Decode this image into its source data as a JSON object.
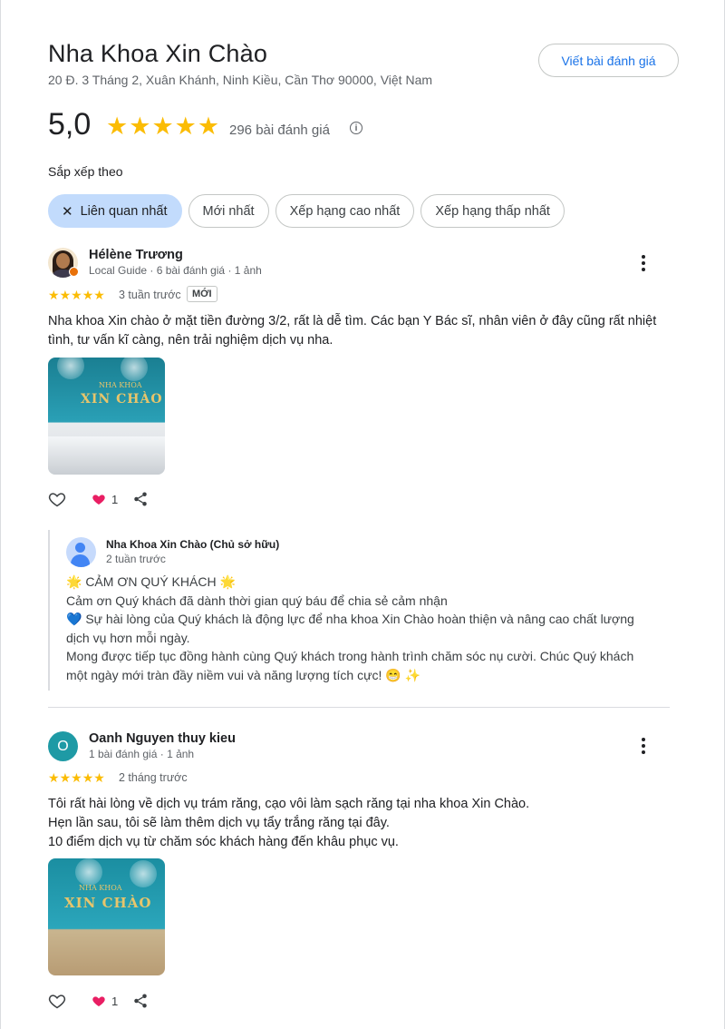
{
  "header": {
    "title": "Nha Khoa Xin Chào",
    "address": "20 Đ. 3 Tháng 2, Xuân Khánh, Ninh Kiều, Cần Thơ 90000, Việt Nam",
    "write_review_label": "Viết bài đánh giá"
  },
  "summary": {
    "rating": "5,0",
    "stars": 5,
    "review_count_label": "296 bài đánh giá",
    "info_icon": "info-icon"
  },
  "sort": {
    "label": "Sắp xếp theo",
    "options": [
      {
        "label": "Liên quan nhất",
        "selected": true
      },
      {
        "label": "Mới nhất",
        "selected": false
      },
      {
        "label": "Xếp hạng cao nhất",
        "selected": false
      },
      {
        "label": "Xếp hạng thấp nhất",
        "selected": false
      }
    ]
  },
  "reviews": [
    {
      "name": "Hélène Trương",
      "meta": "Local Guide · 6 bài đánh giá · 1 ảnh",
      "stars": 5,
      "time": "3 tuần trước",
      "badge": "MỚI",
      "text_lines": [
        "Nha khoa Xin chào ở mặt tiền đường 3/2, rất là dễ tìm. Các bạn Y Bác sĩ, nhân viên ở đây cũng rất nhiệt",
        "tình, tư vấn kĩ càng, nên trải nghiệm dịch vụ nha."
      ],
      "photo_sign_small": "NHA KHOA",
      "photo_sign": "XIN CHÀO",
      "likes": "1",
      "owner_reply": {
        "name": "Nha Khoa Xin Chào (Chủ sở hữu)",
        "time": "2 tuần trước",
        "lines": [
          "🌟 CẢM ƠN QUÝ KHÁCH 🌟",
          "Cảm ơn Quý khách đã dành thời gian quý báu để chia sẻ cảm nhận",
          "💙 Sự hài lòng của Quý khách là động lực để nha khoa Xin Chào hoàn thiện và nâng cao chất lượng",
          "dịch vụ hơn mỗi ngày.",
          "Mong được tiếp tục đồng hành cùng Quý khách trong hành trình chăm sóc nụ cười. Chúc Quý khách",
          "một ngày mới tràn đầy niềm vui và năng lượng tích cực! 😁 ✨"
        ]
      }
    },
    {
      "name": "Oanh Nguyen thuy kieu",
      "avatar_letter": "O",
      "meta": "1 bài đánh giá · 1 ảnh",
      "stars": 5,
      "time": "2 tháng trước",
      "text_lines": [
        "Tôi rất hài lòng về dịch vụ trám răng, cạo vôi làm sạch răng tại nha khoa Xin Chào.",
        "Hẹn lần sau, tôi sẽ làm thêm dịch vụ tẩy trắng răng tại đây.",
        "10 điểm dịch vụ từ chăm sóc khách hàng đến khâu phục vụ."
      ],
      "photo_sign_small": "NHA KHOA",
      "photo_sign": "XIN CHÀO",
      "likes": "1"
    }
  ],
  "colors": {
    "star": "#fbbc04",
    "accent": "#1a73e8",
    "chip_selected": "#c2dbfc",
    "like_heart": "#e91e63"
  }
}
